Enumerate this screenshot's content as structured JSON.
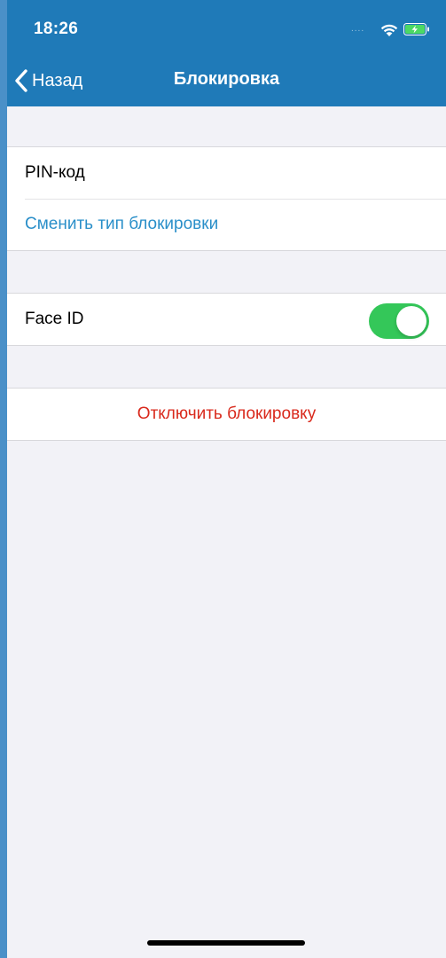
{
  "status_bar": {
    "time": "18:26",
    "signal": "....",
    "wifi_icon": "wifi-icon",
    "battery_icon": "battery-charging-icon"
  },
  "nav": {
    "back_label": "Назад",
    "title": "Блокировка"
  },
  "sections": {
    "lock": {
      "pin_label": "PIN-код",
      "change_type_label": "Сменить тип блокировки"
    },
    "biometry": {
      "face_id_label": "Face ID",
      "face_id_enabled": true
    },
    "disable": {
      "label": "Отключить блокировку"
    }
  },
  "colors": {
    "nav_background": "#1f7ab8",
    "link": "#2a8fc9",
    "danger": "#d9291c",
    "toggle_on": "#34c759",
    "page_background": "#f2f2f7"
  }
}
